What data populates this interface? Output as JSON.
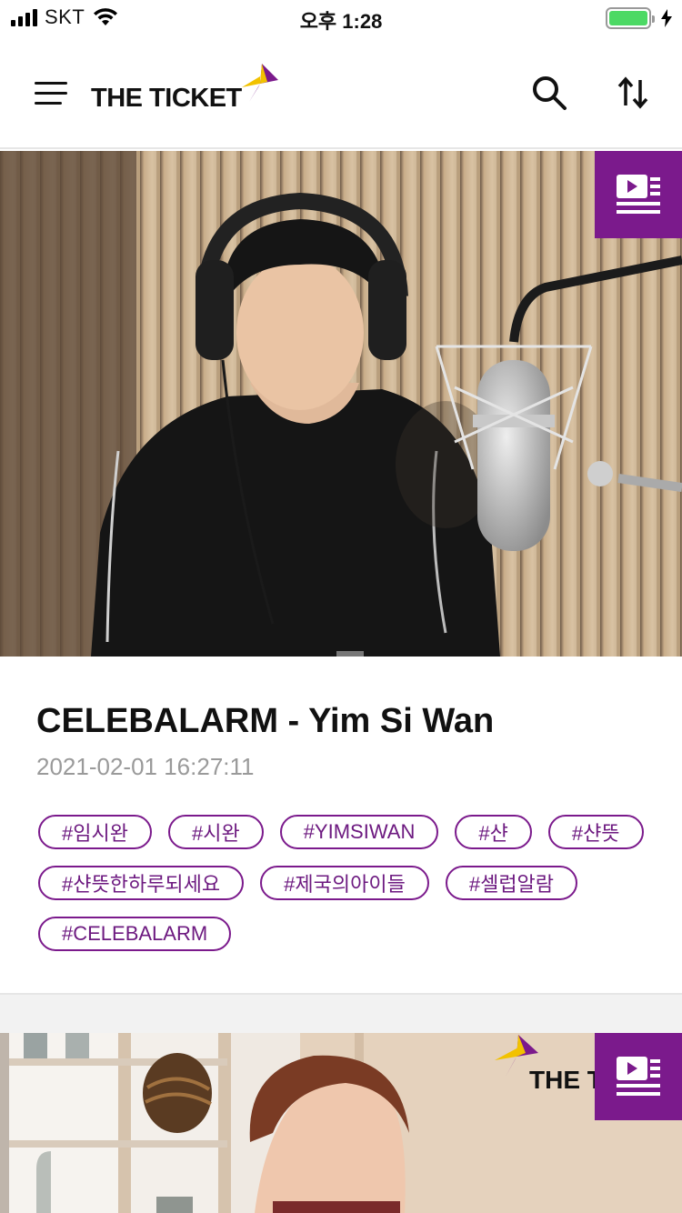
{
  "status_bar": {
    "carrier": "SKT",
    "time": "오후 1:28"
  },
  "header": {
    "logo_text": "THE TICKET",
    "menu_icon": "hamburger-menu-icon",
    "search_icon": "search-icon",
    "sort_icon": "sort-arrows-icon"
  },
  "colors": {
    "accent": "#7b1a8c",
    "logo_yellow": "#f2c200"
  },
  "cards": [
    {
      "title": "CELEBALARM - Yim Si Wan",
      "date": "2021-02-01 16:27:11",
      "badge_icon": "video-article-icon",
      "tags": [
        "#임시완",
        "#시완",
        "#YIMSIWAN",
        "#샨",
        "#샨뜻",
        "#샨뜻한하루되세요",
        "#제국의아이들",
        "#셀럽알람",
        "#CELEBALARM"
      ]
    },
    {
      "badge_icon": "video-article-icon",
      "watermark_text": "THE T"
    }
  ]
}
